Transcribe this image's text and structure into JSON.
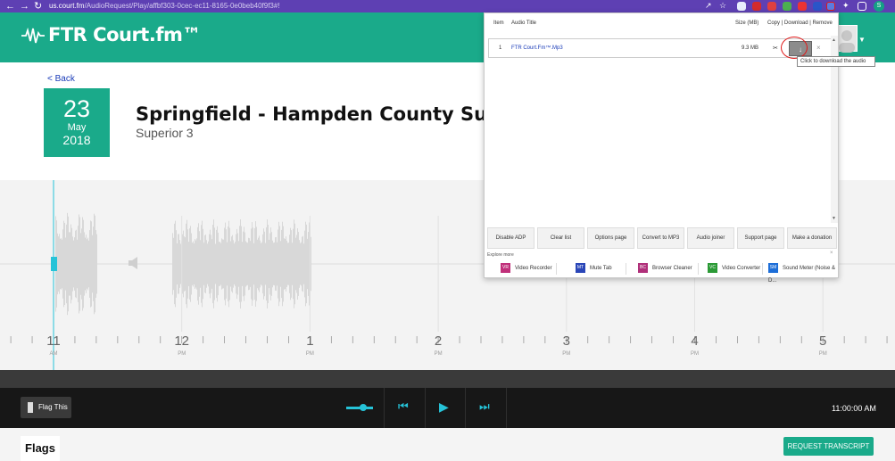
{
  "browser": {
    "url_host": "us.court.fm",
    "url_path": "/AudioRequest/Play/affbf303-0cec-ec11-8165-0e0beb40f9f3#!",
    "profile_initial": "S"
  },
  "app": {
    "logo_text": "FTR Court.fm™",
    "back_label": "< Back"
  },
  "recording": {
    "day": "23",
    "month": "May",
    "year": "2018",
    "court_name": "Springfield - Hampden County Superior C",
    "room": "Superior 3"
  },
  "timeline": {
    "hours": [
      {
        "label": "11",
        "ampm": "AM"
      },
      {
        "label": "12",
        "ampm": "PM"
      },
      {
        "label": "1",
        "ampm": "PM"
      },
      {
        "label": "2",
        "ampm": "PM"
      },
      {
        "label": "3",
        "ampm": "PM"
      },
      {
        "label": "4",
        "ampm": "PM"
      },
      {
        "label": "5",
        "ampm": "PM"
      }
    ]
  },
  "player": {
    "flag_label": "Flag This",
    "current_time": "11:00:00 AM",
    "icons": [
      "flag-icon",
      "volume-slider",
      "skip-back-icon",
      "play-icon",
      "skip-forward-icon"
    ]
  },
  "bottom": {
    "flags_tab": "Flags",
    "request_transcript": "REQUEST TRANSCRIPT"
  },
  "extension_popup": {
    "headers": {
      "item": "Item",
      "audio_title": "Audio Title",
      "size": "Size (MB)",
      "actions": "Copy | Download | Remove"
    },
    "rows": [
      {
        "item": "1",
        "title": "FTR Court.Fm™.Mp3",
        "size": "9.3 MB"
      }
    ],
    "tooltip": "Click to download the audio",
    "buttons": [
      "Disable ADP",
      "Clear list",
      "Options page",
      "Convert to MP3",
      "Audio joiner",
      "Support page",
      "Make a donation"
    ],
    "explore_label": "Explore more",
    "promos": [
      {
        "badge": "VR",
        "label": "Video Recorder",
        "color": "#c0307a"
      },
      {
        "badge": "MT",
        "label": "Mute Tab",
        "color": "#2a46b8"
      },
      {
        "badge": "BC",
        "label": "Browser Cleaner",
        "color": "#b0307a"
      },
      {
        "badge": "VC",
        "label": "Video Converter",
        "color": "#2b9a36"
      },
      {
        "badge": "SM",
        "label": "Sound Meter (Noise & D...",
        "color": "#1d6ed8"
      }
    ]
  },
  "colors": {
    "brand": "#1aaa8a",
    "browser_bar": "#5e40b3",
    "accent": "#26c3d8"
  }
}
